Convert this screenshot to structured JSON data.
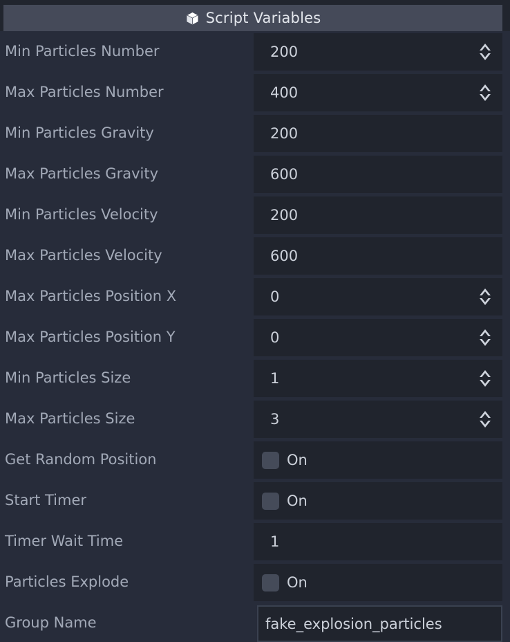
{
  "header": {
    "icon": "cube-icon",
    "title": "Script Variables",
    "background_color": "#454a59",
    "text_color": "#e3e6ec"
  },
  "theme": {
    "panel_background": "#21252e",
    "row_background": "#272c3a",
    "field_background": "#20242d",
    "label_color": "#a2a9b7",
    "value_color": "#ccd1da",
    "checkbox_color": "#454b59",
    "outline_color": "#3a4150"
  },
  "properties": [
    {
      "label": "Min Particles Number",
      "value": "200",
      "control": "spinbox"
    },
    {
      "label": "Max Particles Number",
      "value": "400",
      "control": "spinbox"
    },
    {
      "label": "Min Particles Gravity",
      "value": "200",
      "control": "number"
    },
    {
      "label": "Max Particles Gravity",
      "value": "600",
      "control": "number"
    },
    {
      "label": "Min Particles Velocity",
      "value": "200",
      "control": "number"
    },
    {
      "label": "Max Particles Velocity",
      "value": "600",
      "control": "number"
    },
    {
      "label": "Max Particles Position X",
      "value": "0",
      "control": "spinbox"
    },
    {
      "label": "Max Particles Position Y",
      "value": "0",
      "control": "spinbox"
    },
    {
      "label": "Min Particles Size",
      "value": "1",
      "control": "spinbox"
    },
    {
      "label": "Max Particles Size",
      "value": "3",
      "control": "spinbox"
    },
    {
      "label": "Get Random Position",
      "value": "On",
      "control": "checkbox",
      "checked": false
    },
    {
      "label": "Start Timer",
      "value": "On",
      "control": "checkbox",
      "checked": false
    },
    {
      "label": "Timer Wait Time",
      "value": "1",
      "control": "number"
    },
    {
      "label": "Particles Explode",
      "value": "On",
      "control": "checkbox",
      "checked": false
    },
    {
      "label": "Group Name",
      "value": "fake_explosion_particles",
      "control": "text"
    }
  ]
}
